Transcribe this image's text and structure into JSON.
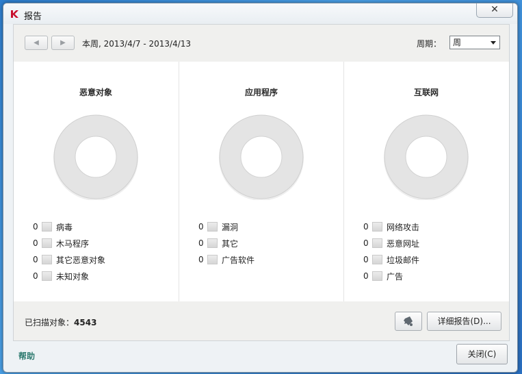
{
  "window": {
    "title": "报告",
    "close_glyph": "✕"
  },
  "toolbar": {
    "prev_glyph": "◀",
    "next_glyph": "▶",
    "date_range": "本周, 2013/4/7 - 2013/4/13",
    "period_label": "周期：",
    "period_value": "周"
  },
  "columns": [
    {
      "title": "恶意对象",
      "items": [
        {
          "count": "0",
          "label": "病毒"
        },
        {
          "count": "0",
          "label": "木马程序"
        },
        {
          "count": "0",
          "label": "其它恶意对象"
        },
        {
          "count": "0",
          "label": "未知对象"
        }
      ]
    },
    {
      "title": "应用程序",
      "items": [
        {
          "count": "0",
          "label": "漏洞"
        },
        {
          "count": "0",
          "label": "其它"
        },
        {
          "count": "0",
          "label": "广告软件"
        }
      ]
    },
    {
      "title": "互联网",
      "items": [
        {
          "count": "0",
          "label": "网络攻击"
        },
        {
          "count": "0",
          "label": "恶意网址"
        },
        {
          "count": "0",
          "label": "垃圾邮件"
        },
        {
          "count": "0",
          "label": "广告"
        }
      ]
    }
  ],
  "footer": {
    "scanned_label": "已扫描对象：",
    "scanned_count": "4543",
    "detail_button": "详细报告(D)...",
    "help_link": "帮助",
    "close_button": "关闭(C)"
  },
  "colors": {
    "brand_red": "#c8102e",
    "help_green": "#2d7a6f"
  }
}
